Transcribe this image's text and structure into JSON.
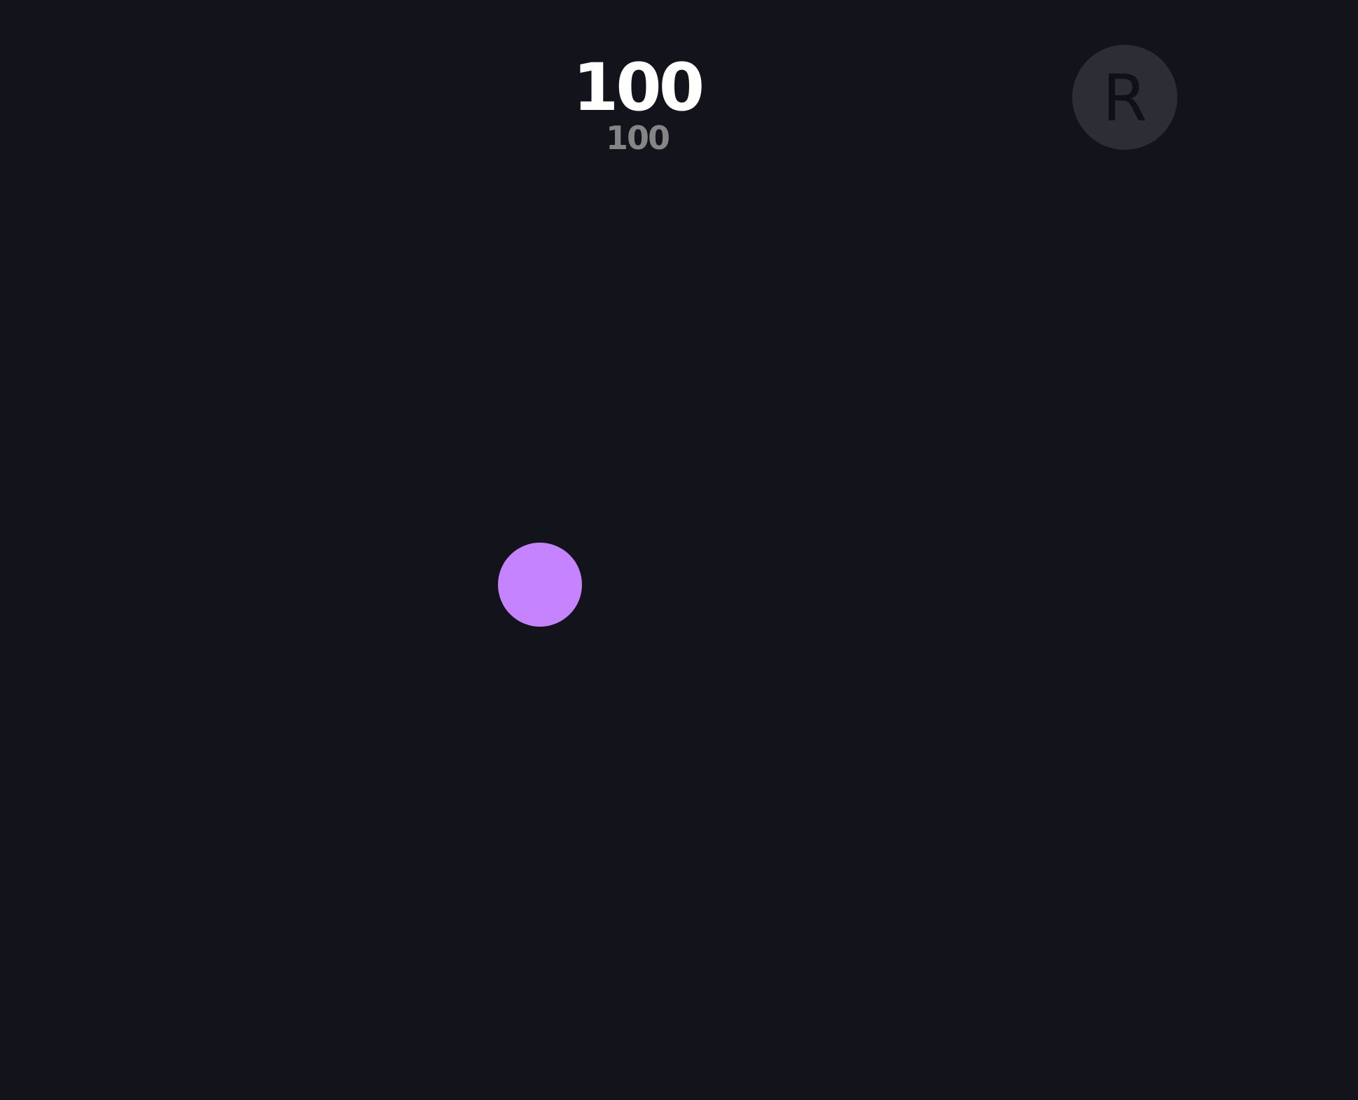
{
  "hud": {
    "score": "100",
    "sub_score": "100"
  },
  "controls": {
    "reset_label": "R"
  },
  "target": {
    "color": "#c683ff"
  },
  "colors": {
    "background": "#13131c",
    "button_bg": "#2d2d36",
    "score_text": "#ffffff",
    "sub_score_text": "#858585"
  }
}
